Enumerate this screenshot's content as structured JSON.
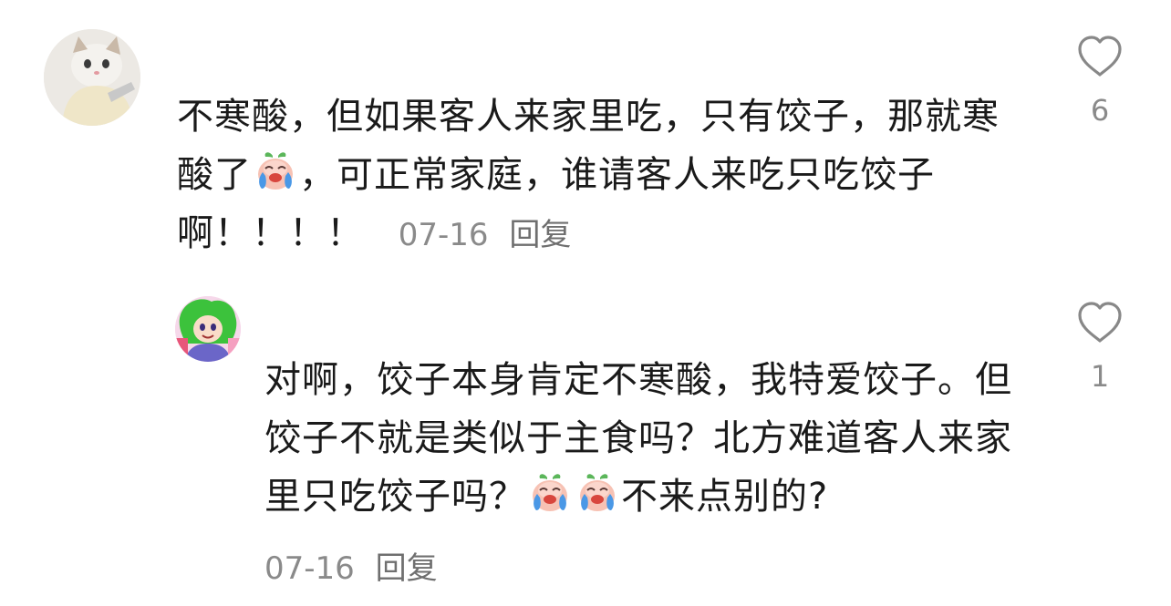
{
  "comments": [
    {
      "text_part1": "不寒酸，但如果客人来家里吃，只有饺子，那就寒酸了",
      "text_part2": "，可正常家庭，谁请客人来吃只吃饺子啊！！！！",
      "date": "07-16",
      "reply_label": "回复",
      "like_count": "6",
      "avatar_icon": "cat-avatar",
      "emoji_icon": "crying-peach-emoji"
    },
    {
      "text_part1": "对啊，饺子本身肯定不寒酸，我特爱饺子。但饺子不就是类似于主食吗？北方难道客人来家里只吃饺子吗？",
      "text_part2": "不来点别的?",
      "date": "07-16",
      "reply_label": "回复",
      "like_count": "1",
      "avatar_icon": "anime-avatar",
      "emoji_icon": "crying-peach-emoji"
    }
  ],
  "colors": {
    "text": "#1a1a1a",
    "meta": "#8a8a8a",
    "heart_outline": "#888888"
  }
}
